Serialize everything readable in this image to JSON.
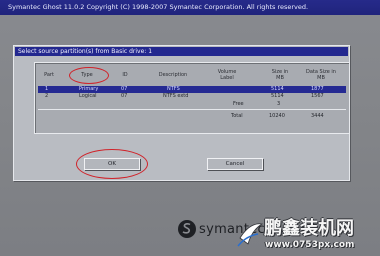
{
  "window": {
    "title": "Symantec Ghost 11.0.2   Copyright (C) 1998-2007 Symantec Corporation. All rights reserved."
  },
  "dialog": {
    "caption": "Select source partition(s) from Basic drive: 1",
    "columns": [
      "Part",
      "Type",
      "ID",
      "Description",
      "Volume Label",
      "Size in MB",
      "Data Size in MB"
    ],
    "rows": [
      {
        "part": "1",
        "type": "Primary",
        "id": "07",
        "description": "NTFS",
        "volume_label": "",
        "size_mb": "5114",
        "data_size_mb": "1877",
        "selected": true
      },
      {
        "part": "2",
        "type": "Logical",
        "id": "07",
        "description": "NTFS extd",
        "volume_label": "",
        "size_mb": "5114",
        "data_size_mb": "1567",
        "selected": false
      }
    ],
    "free": {
      "label": "Free",
      "size_mb": "3"
    },
    "total": {
      "label": "Total",
      "size_mb": "10240",
      "data_size_mb": "3444"
    },
    "buttons": {
      "ok": "OK",
      "cancel": "Cancel"
    }
  },
  "branding": {
    "logo_text": "symantec",
    "watermark_cn": "鹏鑫装机网",
    "watermark_url": "www.0753px.com"
  },
  "colors": {
    "title_bar": "#23288f",
    "dialog_bg": "#b9bcc2",
    "selection": "#252a92",
    "annotation_red": "#d0232a"
  }
}
